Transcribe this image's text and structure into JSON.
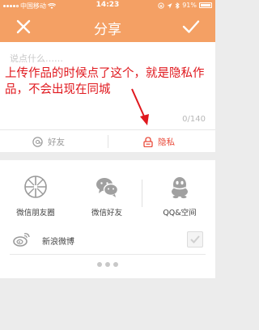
{
  "status_bar": {
    "carrier": "中国移动",
    "time": "14:23",
    "battery": "91%",
    "signal_bars": 4
  },
  "nav": {
    "title": "分享",
    "close_icon": "close-icon",
    "confirm_icon": "check-icon"
  },
  "compose": {
    "placeholder": "说点什么……",
    "char_count": "0/140"
  },
  "annotation": {
    "text": "上传作品的时候点了这个，就是隐私作品，不会出现在同城",
    "color": "#e0181e"
  },
  "visibility": {
    "friends_label": "好友",
    "private_label": "隐私",
    "private_color": "#e94a3a"
  },
  "share": {
    "wechat_moments": "微信朋友圈",
    "wechat_friends": "微信好友",
    "qq": "QQ&空间",
    "weibo": "新浪微博"
  },
  "colors": {
    "accent": "#f4a064"
  }
}
